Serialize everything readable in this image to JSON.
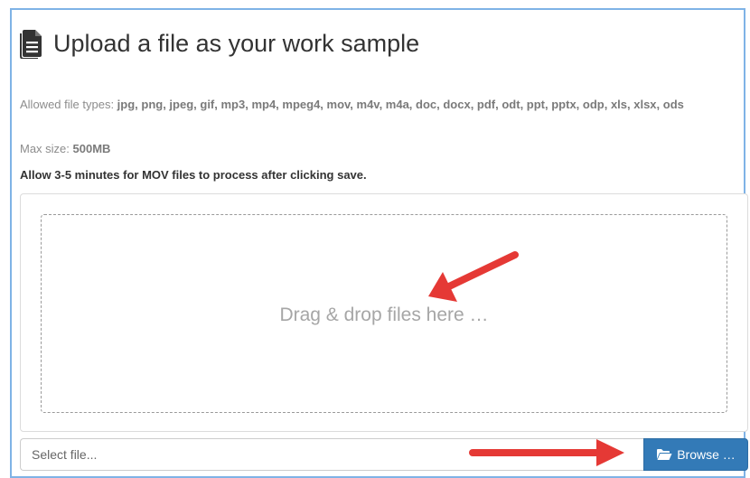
{
  "header": {
    "icon": "file-text-icon",
    "title": "Upload a file as your work sample"
  },
  "info": {
    "allowed_label": "Allowed file types: ",
    "allowed_types": "jpg, png, jpeg, gif, mp3, mp4, mpeg4, mov, m4v, m4a, doc, docx, pdf, odt, ppt, pptx, odp, xls, xlsx, ods",
    "max_label": "Max size: ",
    "max_value": "500MB",
    "notice": "Allow 3-5 minutes for MOV files to process after clicking save."
  },
  "dropzone": {
    "text": "Drag & drop files here …"
  },
  "file_input": {
    "placeholder": "Select file...",
    "value": ""
  },
  "browse": {
    "icon": "folder-open-icon",
    "label": "Browse …"
  },
  "annotations": {
    "arrow_color": "#e53935"
  },
  "colors": {
    "frame_border": "#7fb3e6",
    "button_blue": "#337ab7"
  }
}
